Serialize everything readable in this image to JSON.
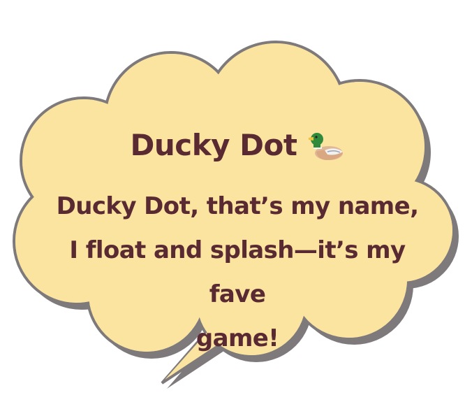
{
  "bubble": {
    "title": "Ducky Dot",
    "icon": "duck-icon",
    "lines": [
      "Ducky Dot, that’s my name,",
      "I float and splash—it’s my fave",
      "game!"
    ]
  },
  "colors": {
    "bubble_fill": "#fbe3a0",
    "bubble_stroke": "#7e7a7c",
    "shadow": "#7e7a7c",
    "text": "#5a2a32"
  }
}
